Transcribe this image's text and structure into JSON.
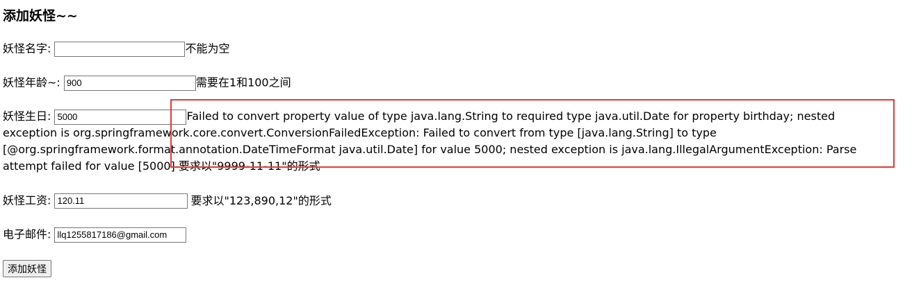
{
  "page": {
    "title": "添加妖怪~~"
  },
  "form": {
    "name": {
      "label": "妖怪名字: ",
      "value": "",
      "error": "不能为空"
    },
    "age": {
      "label": "妖怪年龄~: ",
      "value": "900",
      "error": "需要在1和100之间"
    },
    "birthday": {
      "label": "妖怪生日: ",
      "value": "5000",
      "error_lines": [
        "Failed to convert property value of type java.lang.String to required type java.util.Date for property birthday; nested",
        "exception is org.springframework.core.convert.ConversionFailedException: Failed to convert from type [java.lang.String] to type",
        "[@org.springframework.format.annotation.DateTimeFormat java.util.Date] for value 5000; nested exception is java.lang.IllegalArgumentException: Parse",
        "attempt failed for value [5000] 要求以\"9999-11-11\"的形式"
      ]
    },
    "salary": {
      "label": "妖怪工资: ",
      "value": "120.11",
      "error": "要求以\"123,890,12\"的形式"
    },
    "email": {
      "label": "电子邮件: ",
      "value": "llq1255817186@gmail.com"
    },
    "submit_label": "添加妖怪"
  },
  "annotation": {
    "color": "#e53935"
  }
}
